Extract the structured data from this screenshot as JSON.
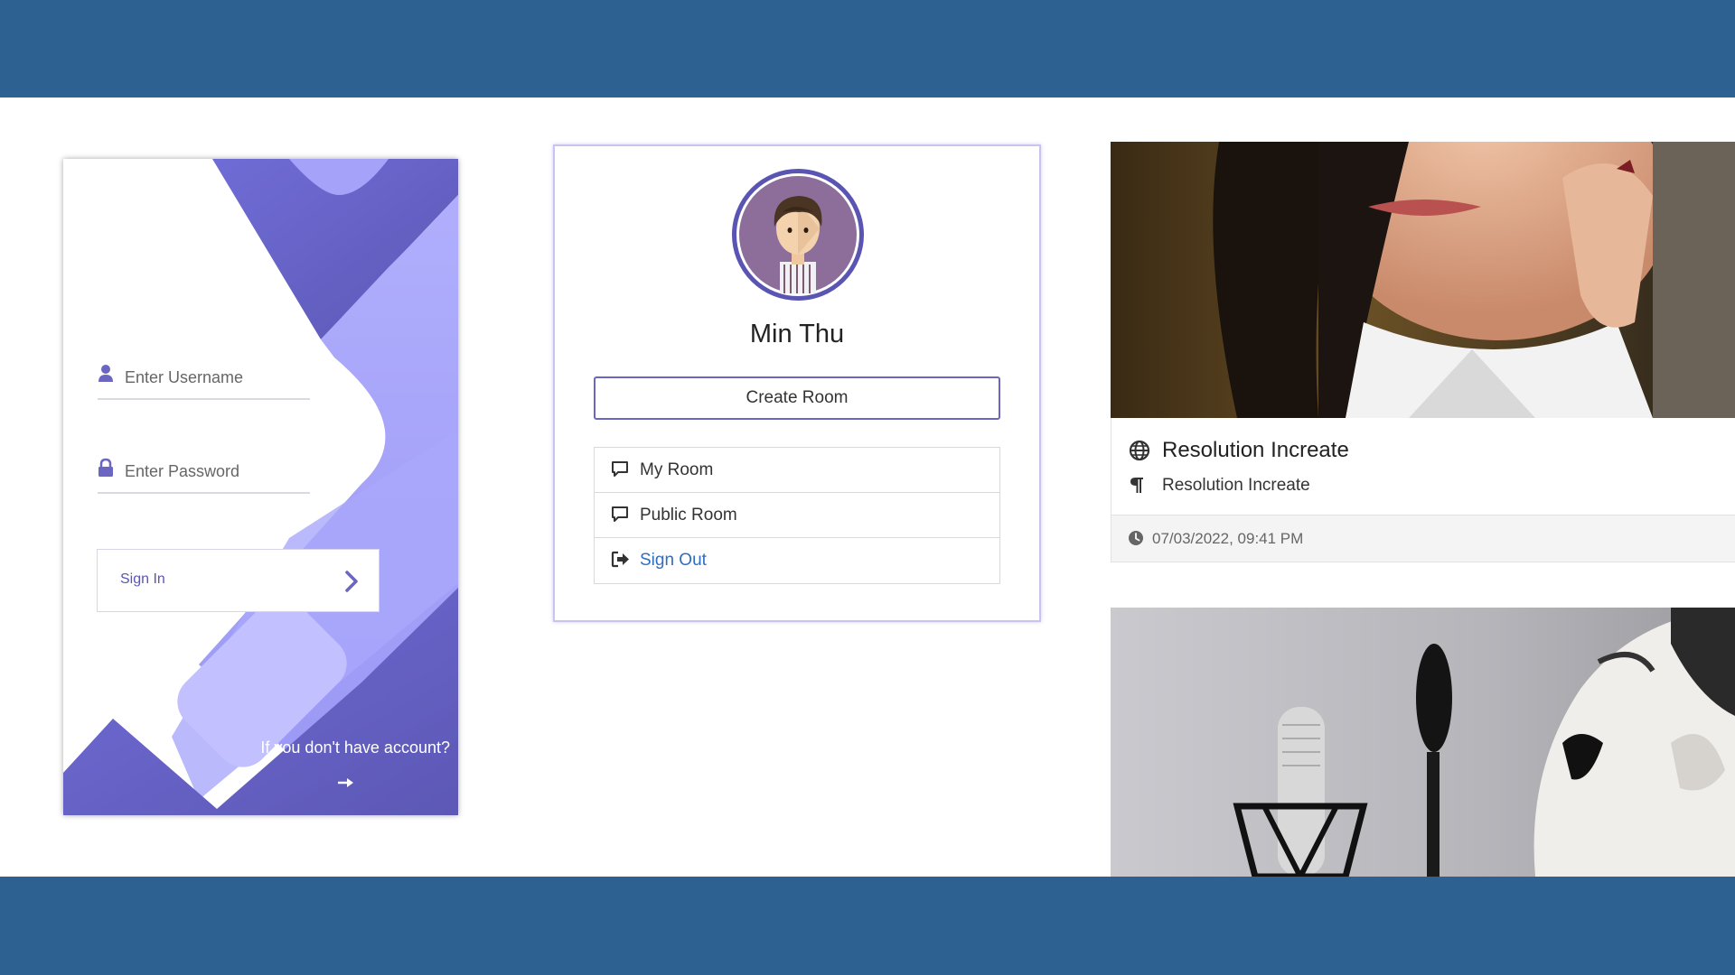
{
  "login": {
    "username_placeholder": "Enter Username",
    "password_placeholder": "Enter Password",
    "signin_label": "Sign In",
    "no_account_text": "If you don't have account?",
    "icons": {
      "user": "user-icon",
      "lock": "lock-icon",
      "chevron": "chevron-right-icon",
      "arrow": "arrow-right-icon"
    },
    "colors": {
      "accent": "#6a66c2",
      "light": "#a4a2f9",
      "dark": "#5f5bb7"
    }
  },
  "profile": {
    "name": "Min Thu",
    "create_room_label": "Create Room",
    "menu": [
      {
        "label": "My Room",
        "icon": "comment-icon"
      },
      {
        "label": "Public Room",
        "icon": "comment-icon"
      },
      {
        "label": "Sign Out",
        "icon": "sign-out-icon"
      }
    ],
    "colors": {
      "avatar_ring": "#5a54b3",
      "link": "#2f6dbf"
    }
  },
  "post": {
    "title": "Resolution Increate",
    "description": "Resolution Increate",
    "timestamp": "07/03/2022, 09:41 PM",
    "icons": {
      "title": "globe-icon",
      "description": "paragraph-icon",
      "time": "clock-icon"
    }
  },
  "theme": {
    "band_color": "#2c6191"
  }
}
